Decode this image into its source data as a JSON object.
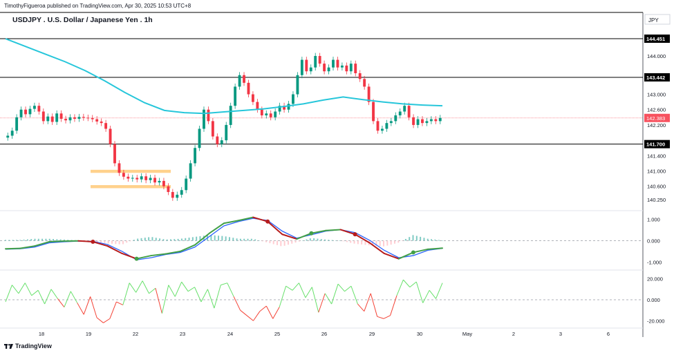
{
  "publisher_line": "TimothyFigueroa published on TradingView.com, Apr 30, 2025 10:53 UTC+8",
  "footer_brand": "TradingView",
  "chart_data": {
    "type": "candlestick",
    "title": "USDJPY . U.S. Dollar / Japanese Yen . 1h",
    "currency": "JPY",
    "x_tick_labels": [
      "18",
      "19",
      "22",
      "23",
      "24",
      "25",
      "26",
      "29",
      "30",
      "May",
      "2",
      "3",
      "6"
    ],
    "price_axis": {
      "ylim": [
        140.0,
        145.1
      ],
      "tick_labels": [
        "144.000",
        "143.000",
        "142.600",
        "142.200",
        "141.400",
        "141.000",
        "140.600",
        "140.250"
      ],
      "level_lines": [
        {
          "value": 144.451,
          "label": "144.451"
        },
        {
          "value": 143.442,
          "label": "143.442"
        },
        {
          "value": 141.7,
          "label": "141.700"
        }
      ],
      "last_price": {
        "value": 142.383,
        "label": "142.383"
      }
    },
    "candles_close": [
      141.92,
      142.05,
      142.4,
      142.6,
      142.48,
      142.62,
      142.7,
      142.55,
      142.3,
      142.42,
      142.28,
      142.5,
      142.36,
      142.32,
      142.4,
      142.36,
      142.41,
      142.39,
      142.38,
      142.35,
      142.29,
      142.25,
      142.1,
      141.7,
      141.2,
      140.95,
      140.85,
      140.8,
      140.82,
      140.78,
      140.86,
      140.76,
      140.82,
      140.7,
      140.74,
      140.6,
      140.45,
      140.3,
      140.38,
      140.5,
      140.8,
      141.2,
      141.6,
      142.1,
      142.6,
      142.3,
      141.9,
      141.7,
      141.8,
      142.2,
      142.7,
      143.2,
      143.5,
      143.3,
      143.0,
      142.8,
      142.6,
      142.45,
      142.5,
      142.4,
      142.55,
      142.7,
      142.6,
      142.75,
      143.0,
      143.5,
      143.9,
      143.6,
      143.7,
      144.0,
      143.8,
      143.6,
      143.7,
      143.9,
      143.7,
      143.75,
      143.6,
      143.8,
      143.55,
      143.4,
      143.2,
      142.8,
      142.3,
      142.05,
      142.1,
      142.25,
      142.3,
      142.45,
      142.55,
      142.7,
      142.4,
      142.2,
      142.35,
      142.25,
      142.3,
      142.35,
      142.3,
      142.383
    ],
    "moving_average": {
      "color": "#26c6da",
      "values": [
        144.45,
        144.25,
        144.05,
        143.85,
        143.62,
        143.35,
        143.05,
        142.78,
        142.58,
        142.52,
        142.5,
        142.54,
        142.58,
        142.62,
        142.68,
        142.75,
        142.85,
        142.93,
        142.86,
        142.8,
        142.75,
        142.72,
        142.7
      ]
    },
    "highlight_boxes": [
      {
        "price_low": 140.95,
        "price_high": 141.03
      },
      {
        "price_low": 140.55,
        "price_high": 140.63
      }
    ],
    "oscillator_1": {
      "tick_labels": [
        "1.000",
        "0.000",
        "-1.000"
      ],
      "ylim": [
        -1.25,
        1.25
      ],
      "fast_line": [
        -0.38,
        -0.36,
        -0.25,
        -0.05,
        -0.02,
        -0.01,
        -0.05,
        -0.25,
        -0.6,
        -0.85,
        -0.7,
        -0.62,
        -0.5,
        -0.2,
        0.35,
        0.82,
        0.95,
        1.1,
        0.9,
        0.3,
        0.08,
        0.35,
        0.48,
        0.52,
        0.3,
        -0.1,
        -0.6,
        -0.85,
        -0.55,
        -0.4,
        -0.35
      ],
      "slow_line": [
        -0.4,
        -0.38,
        -0.3,
        -0.1,
        -0.05,
        -0.02,
        -0.03,
        -0.18,
        -0.5,
        -0.9,
        -0.8,
        -0.65,
        -0.55,
        -0.3,
        0.2,
        0.7,
        0.9,
        1.05,
        0.95,
        0.45,
        0.12,
        0.28,
        0.45,
        0.52,
        0.38,
        0.02,
        -0.45,
        -0.8,
        -0.7,
        -0.45,
        -0.36
      ]
    },
    "oscillator_2": {
      "tick_labels": [
        "20.000",
        "0.000",
        "-20.000"
      ],
      "ylim": [
        -25,
        25
      ],
      "values": [
        -2,
        14,
        6,
        16,
        4,
        9,
        -4,
        10,
        1,
        -7,
        8,
        -3,
        -14,
        3,
        -17,
        -22,
        -18,
        -2,
        -5,
        16,
        7,
        18,
        6,
        11,
        -13,
        14,
        3,
        17,
        8,
        12,
        -2,
        10,
        -8,
        14,
        16,
        3,
        -10,
        -15,
        -20,
        -11,
        -6,
        -18,
        -7,
        13,
        9,
        16,
        2,
        12,
        -12,
        6,
        -4,
        15,
        8,
        13,
        -4,
        -11,
        6,
        -16,
        -18,
        -15,
        4,
        19,
        12,
        17,
        -3,
        9,
        1,
        16
      ]
    }
  }
}
